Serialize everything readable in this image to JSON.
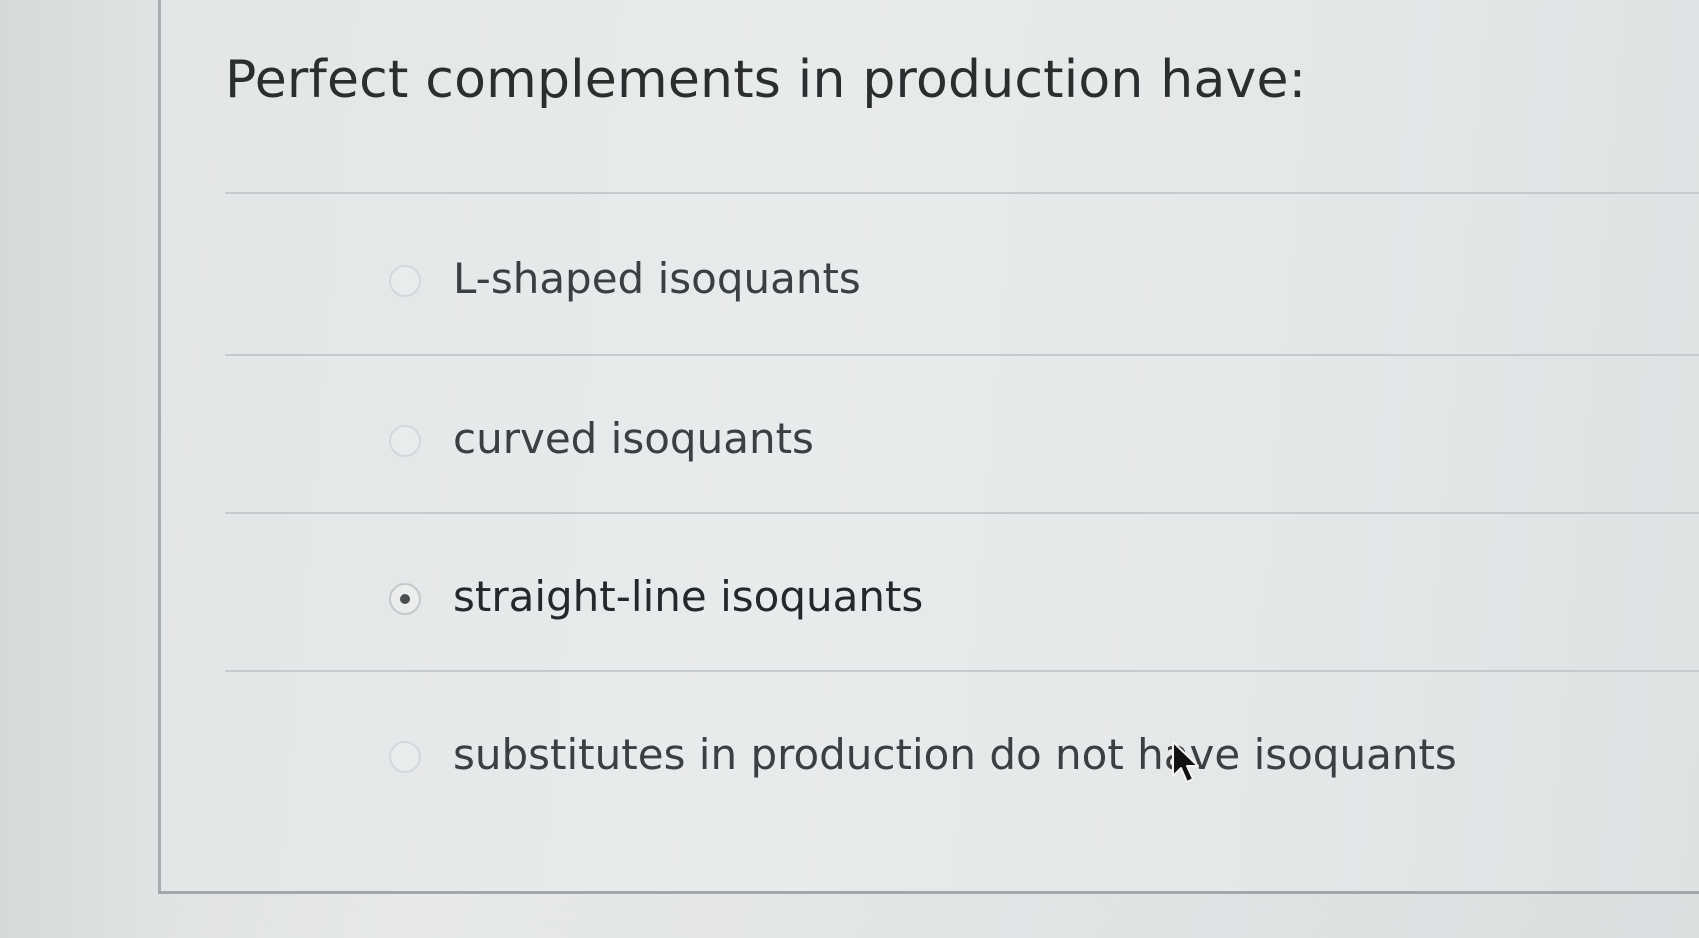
{
  "question": {
    "text": "Perfect complements in production have:"
  },
  "options": [
    {
      "label": "L-shaped isoquants",
      "selected": false
    },
    {
      "label": "curved isoquants",
      "selected": false
    },
    {
      "label": "straight-line isoquants",
      "selected": true
    },
    {
      "label": "substitutes in production do not have isoquants",
      "selected": false
    }
  ],
  "colors": {
    "background": "#e4e7e8",
    "text": "#2b2d2f",
    "divider": "#c7cacc",
    "radio_dot": "#4b4e51"
  },
  "icons": {
    "cursor": "mouse-pointer-arrow"
  }
}
